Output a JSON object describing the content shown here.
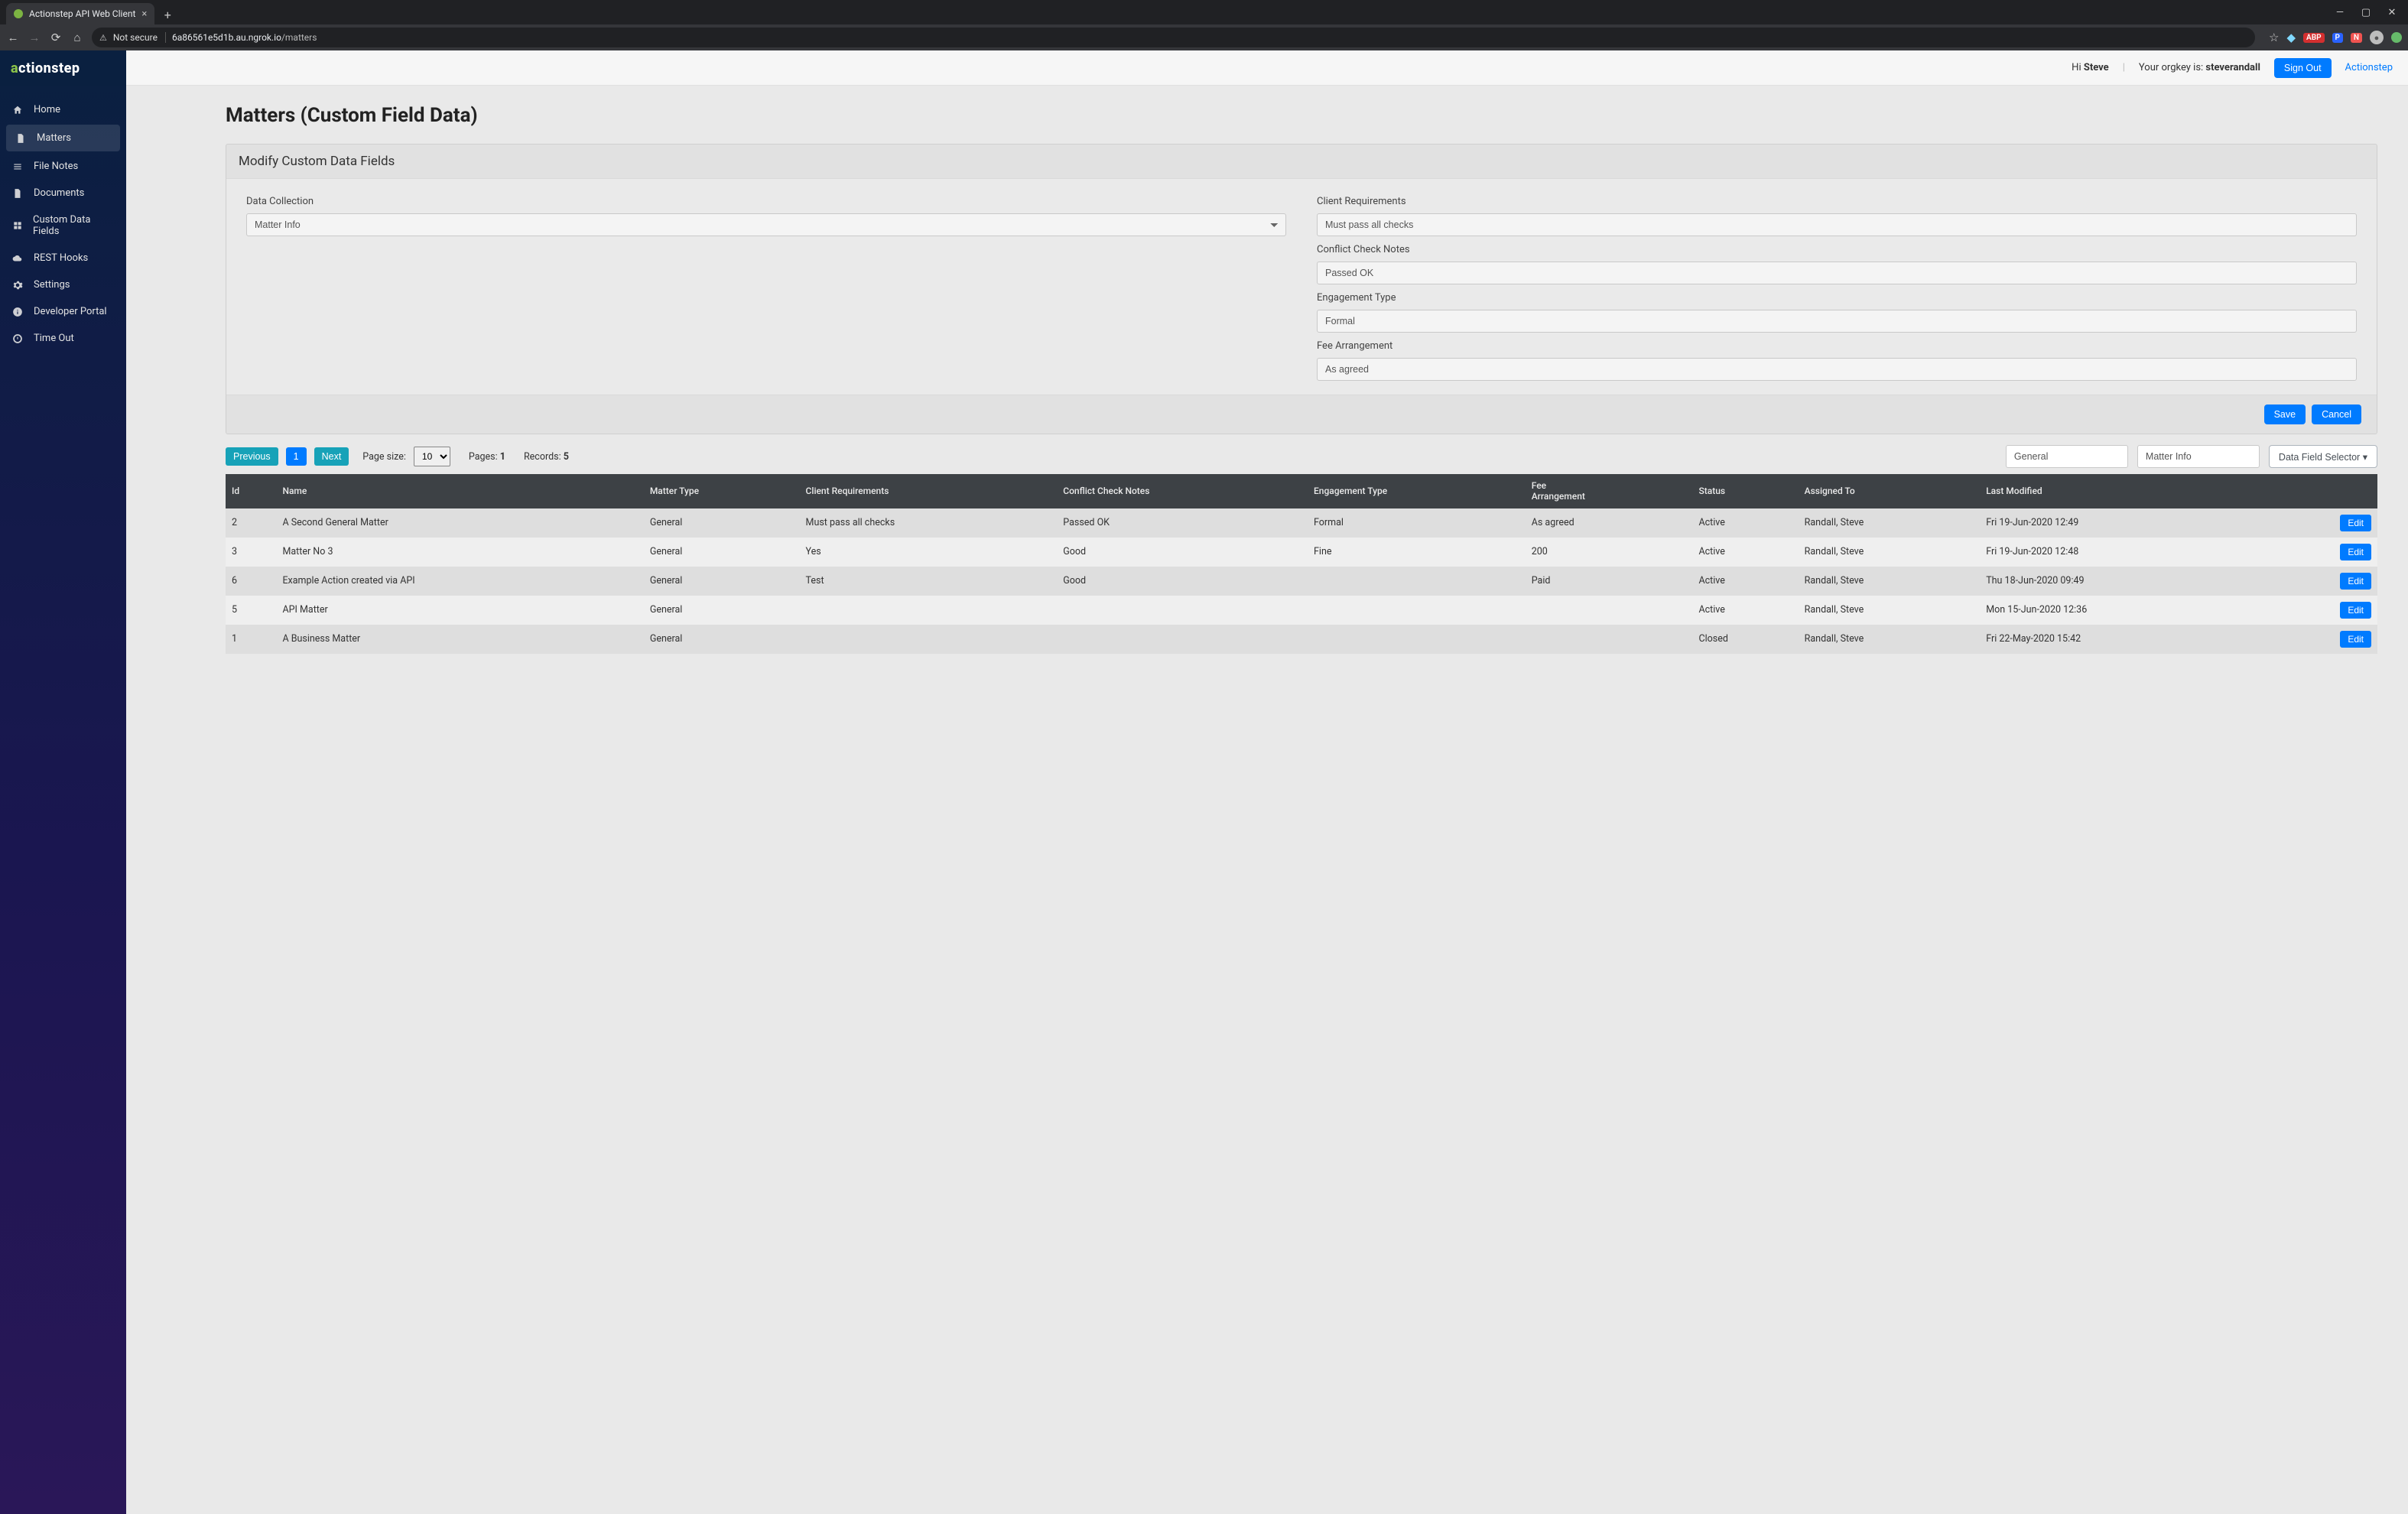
{
  "browser": {
    "tab_title": "Actionstep API Web Client",
    "not_secure_label": "Not secure",
    "url_host": "6a86561e5d1b.au.ngrok.io",
    "url_path": "/matters"
  },
  "brand": {
    "part_a": "a",
    "part_rest": "ctionstep"
  },
  "sidebar": {
    "items": [
      {
        "label": "Home"
      },
      {
        "label": "Matters"
      },
      {
        "label": "File Notes"
      },
      {
        "label": "Documents"
      },
      {
        "label": "Custom Data Fields"
      },
      {
        "label": "REST Hooks"
      },
      {
        "label": "Settings"
      },
      {
        "label": "Developer Portal"
      },
      {
        "label": "Time Out"
      }
    ]
  },
  "topbar": {
    "greeting_prefix": "Hi ",
    "user_name": "Steve",
    "orgkey_prefix": "Your orgkey is: ",
    "orgkey": "steverandall",
    "signout_label": "Sign Out",
    "brand_link": "Actionstep"
  },
  "page": {
    "title": "Matters (Custom Field Data)",
    "card_title": "Modify Custom Data Fields",
    "data_collection": {
      "label": "Data Collection",
      "value": "Matter Info"
    },
    "fields": [
      {
        "label": "Client Requirements",
        "value": "Must pass all checks"
      },
      {
        "label": "Conflict Check Notes",
        "value": "Passed OK"
      },
      {
        "label": "Engagement Type",
        "value": "Formal"
      },
      {
        "label": "Fee Arrangement",
        "value": "As agreed"
      }
    ],
    "save_label": "Save",
    "cancel_label": "Cancel"
  },
  "pager": {
    "prev": "Previous",
    "page": "1",
    "next": "Next",
    "page_size_label": "Page size:",
    "page_size_value": "10",
    "pages_label": "Pages:",
    "pages_value": "1",
    "records_label": "Records:",
    "records_value": "5",
    "filter1": "General",
    "filter2": "Matter Info",
    "dfs_label": "Data Field Selector"
  },
  "table": {
    "headers": {
      "id": "Id",
      "name": "Name",
      "matter_type": "Matter Type",
      "client_req": "Client Requirements",
      "conflict": "Conflict Check Notes",
      "engagement": "Engagement Type",
      "fee_line1": "Fee",
      "fee_line2": "Arrangement",
      "status": "Status",
      "assigned": "Assigned To",
      "modified": "Last Modified"
    },
    "edit_label": "Edit",
    "rows": [
      {
        "id": "2",
        "name": "A Second General Matter",
        "matter_type": "General",
        "client_req": "Must pass all checks",
        "conflict": "Passed OK",
        "engagement": "Formal",
        "fee": "As agreed",
        "status": "Active",
        "assigned": "Randall, Steve",
        "modified": "Fri 19-Jun-2020 12:49"
      },
      {
        "id": "3",
        "name": "Matter No 3",
        "matter_type": "General",
        "client_req": "Yes",
        "conflict": "Good",
        "engagement": "Fine",
        "fee": "200",
        "status": "Active",
        "assigned": "Randall, Steve",
        "modified": "Fri 19-Jun-2020 12:48"
      },
      {
        "id": "6",
        "name": "Example Action created via API",
        "matter_type": "General",
        "client_req": "Test",
        "conflict": "Good",
        "engagement": "",
        "fee": "Paid",
        "status": "Active",
        "assigned": "Randall, Steve",
        "modified": "Thu 18-Jun-2020 09:49"
      },
      {
        "id": "5",
        "name": "API Matter",
        "matter_type": "General",
        "client_req": "",
        "conflict": "",
        "engagement": "",
        "fee": "",
        "status": "Active",
        "assigned": "Randall, Steve",
        "modified": "Mon 15-Jun-2020 12:36"
      },
      {
        "id": "1",
        "name": "A Business Matter",
        "matter_type": "General",
        "client_req": "",
        "conflict": "",
        "engagement": "",
        "fee": "",
        "status": "Closed",
        "assigned": "Randall, Steve",
        "modified": "Fri 22-May-2020 15:42"
      }
    ]
  }
}
